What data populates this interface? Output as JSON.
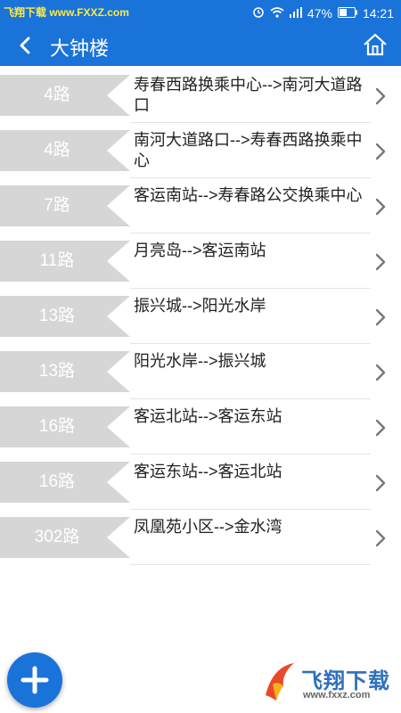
{
  "status": {
    "watermark_text": "飞翔下载 www.FXXZ.com",
    "battery": "47%",
    "time": "14:21"
  },
  "header": {
    "title": "大钟楼"
  },
  "routes": [
    {
      "line": "4路",
      "desc": "寿春西路换乘中心-->南河大道路口"
    },
    {
      "line": "4路",
      "desc": "南河大道路口-->寿春西路换乘中心"
    },
    {
      "line": "7路",
      "desc": "客运南站-->寿春路公交换乘中心"
    },
    {
      "line": "11路",
      "desc": "月亮岛-->客运南站"
    },
    {
      "line": "13路",
      "desc": "振兴城-->阳光水岸"
    },
    {
      "line": "13路",
      "desc": "阳光水岸-->振兴城"
    },
    {
      "line": "16路",
      "desc": "客运北站-->客运东站"
    },
    {
      "line": "16路",
      "desc": "客运东站-->客运北站"
    },
    {
      "line": "302路",
      "desc": "凤凰苑小区-->金水湾"
    }
  ],
  "watermark": {
    "brand": "飞翔下载",
    "url": "www.fxxz.com"
  },
  "colors": {
    "primary": "#1a73d9",
    "badge": "#d6d6d6"
  }
}
